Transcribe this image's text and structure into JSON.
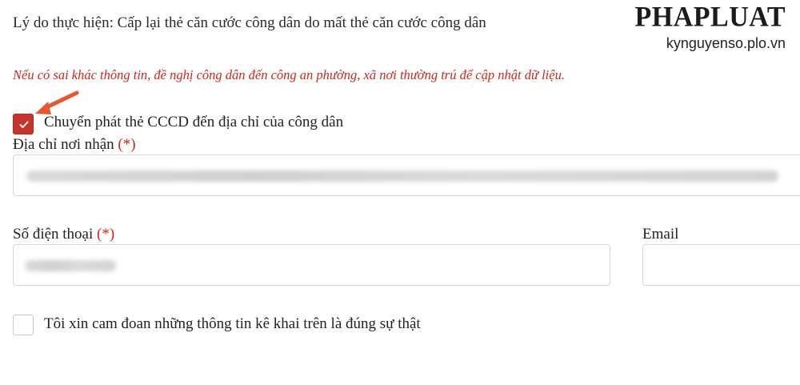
{
  "form": {
    "reason_text": "Lý do thực hiện: Cấp lại thẻ căn cước công dân do mất thẻ căn cước công dân",
    "notice_text": "Nếu có sai khác thông tin, đề nghị công dân đến công an phường, xã nơi thường trú để cập nhật dữ liệu.",
    "delivery_checkbox": {
      "label": "Chuyển phát thẻ CCCD đến địa chỉ của công dân",
      "checked": true
    },
    "address": {
      "label": "Địa chỉ nơi nhận",
      "required_mark": "(*)",
      "value": ""
    },
    "phone": {
      "label": "Số điện thoại",
      "required_mark": "(*)",
      "value": ""
    },
    "email": {
      "label": "Email",
      "value": ""
    },
    "commitment_checkbox": {
      "label": "Tôi xin cam đoan những thông tin kê khai trên là đúng sự thật",
      "checked": false
    }
  },
  "watermark": {
    "brand": "PHAPLUAT",
    "url": "kynguyenso.plo.vn"
  },
  "colors": {
    "accent_red": "#c8332c",
    "required_red": "#d0261b",
    "annotation_arrow": "#e8572e"
  },
  "icons": {
    "checkbox_check": "check-icon",
    "annotation": "arrow-icon"
  }
}
